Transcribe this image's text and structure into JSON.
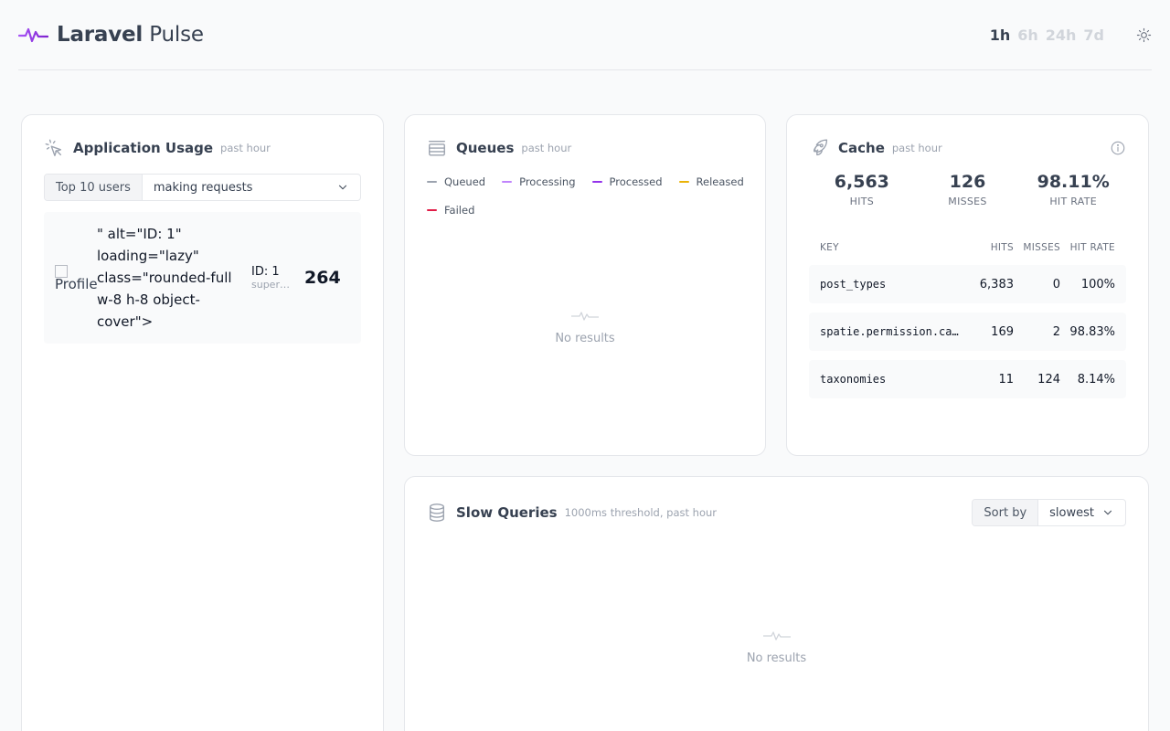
{
  "header": {
    "brand_bold": "Laravel",
    "brand_light": "Pulse",
    "periods": [
      "1h",
      "6h",
      "24h",
      "7d"
    ],
    "active_period": "1h",
    "theme_icon": "sun-icon"
  },
  "usage": {
    "title": "Application Usage",
    "subtitle": "past hour",
    "select_label": "Top 10 users",
    "select_value": "making requests",
    "users": [
      {
        "avatar_alt": "Profile",
        "alt_text": "\" alt=\"ID: 1\" loading=\"lazy\" class=\"rounded-full w-8 h-8 object-cover\">",
        "id_label": "ID: 1",
        "subtitle": "superadmin",
        "count": "264"
      }
    ]
  },
  "queues": {
    "title": "Queues",
    "subtitle": "past hour",
    "legend": [
      {
        "label": "Queued",
        "color": "#9ca3af"
      },
      {
        "label": "Processing",
        "color": "#c084fc"
      },
      {
        "label": "Processed",
        "color": "#9333ea"
      },
      {
        "label": "Released",
        "color": "#eab308"
      },
      {
        "label": "Failed",
        "color": "#e11d48"
      }
    ],
    "empty_text": "No results"
  },
  "cache": {
    "title": "Cache",
    "subtitle": "past hour",
    "stats": [
      {
        "value": "6,563",
        "label": "HITS"
      },
      {
        "value": "126",
        "label": "MISSES"
      },
      {
        "value": "98.11%",
        "label": "HIT RATE"
      }
    ],
    "columns": [
      "KEY",
      "HITS",
      "MISSES",
      "HIT RATE"
    ],
    "rows": [
      {
        "key": "post_types",
        "hits": "6,383",
        "misses": "0",
        "rate": "100%"
      },
      {
        "key": "spatie.permission.cache",
        "hits": "169",
        "misses": "2",
        "rate": "98.83%"
      },
      {
        "key": "taxonomies",
        "hits": "11",
        "misses": "124",
        "rate": "8.14%"
      }
    ]
  },
  "slow_queries": {
    "title": "Slow Queries",
    "subtitle": "1000ms threshold, past hour",
    "sort_label": "Sort by",
    "sort_value": "slowest",
    "empty_text": "No results"
  }
}
